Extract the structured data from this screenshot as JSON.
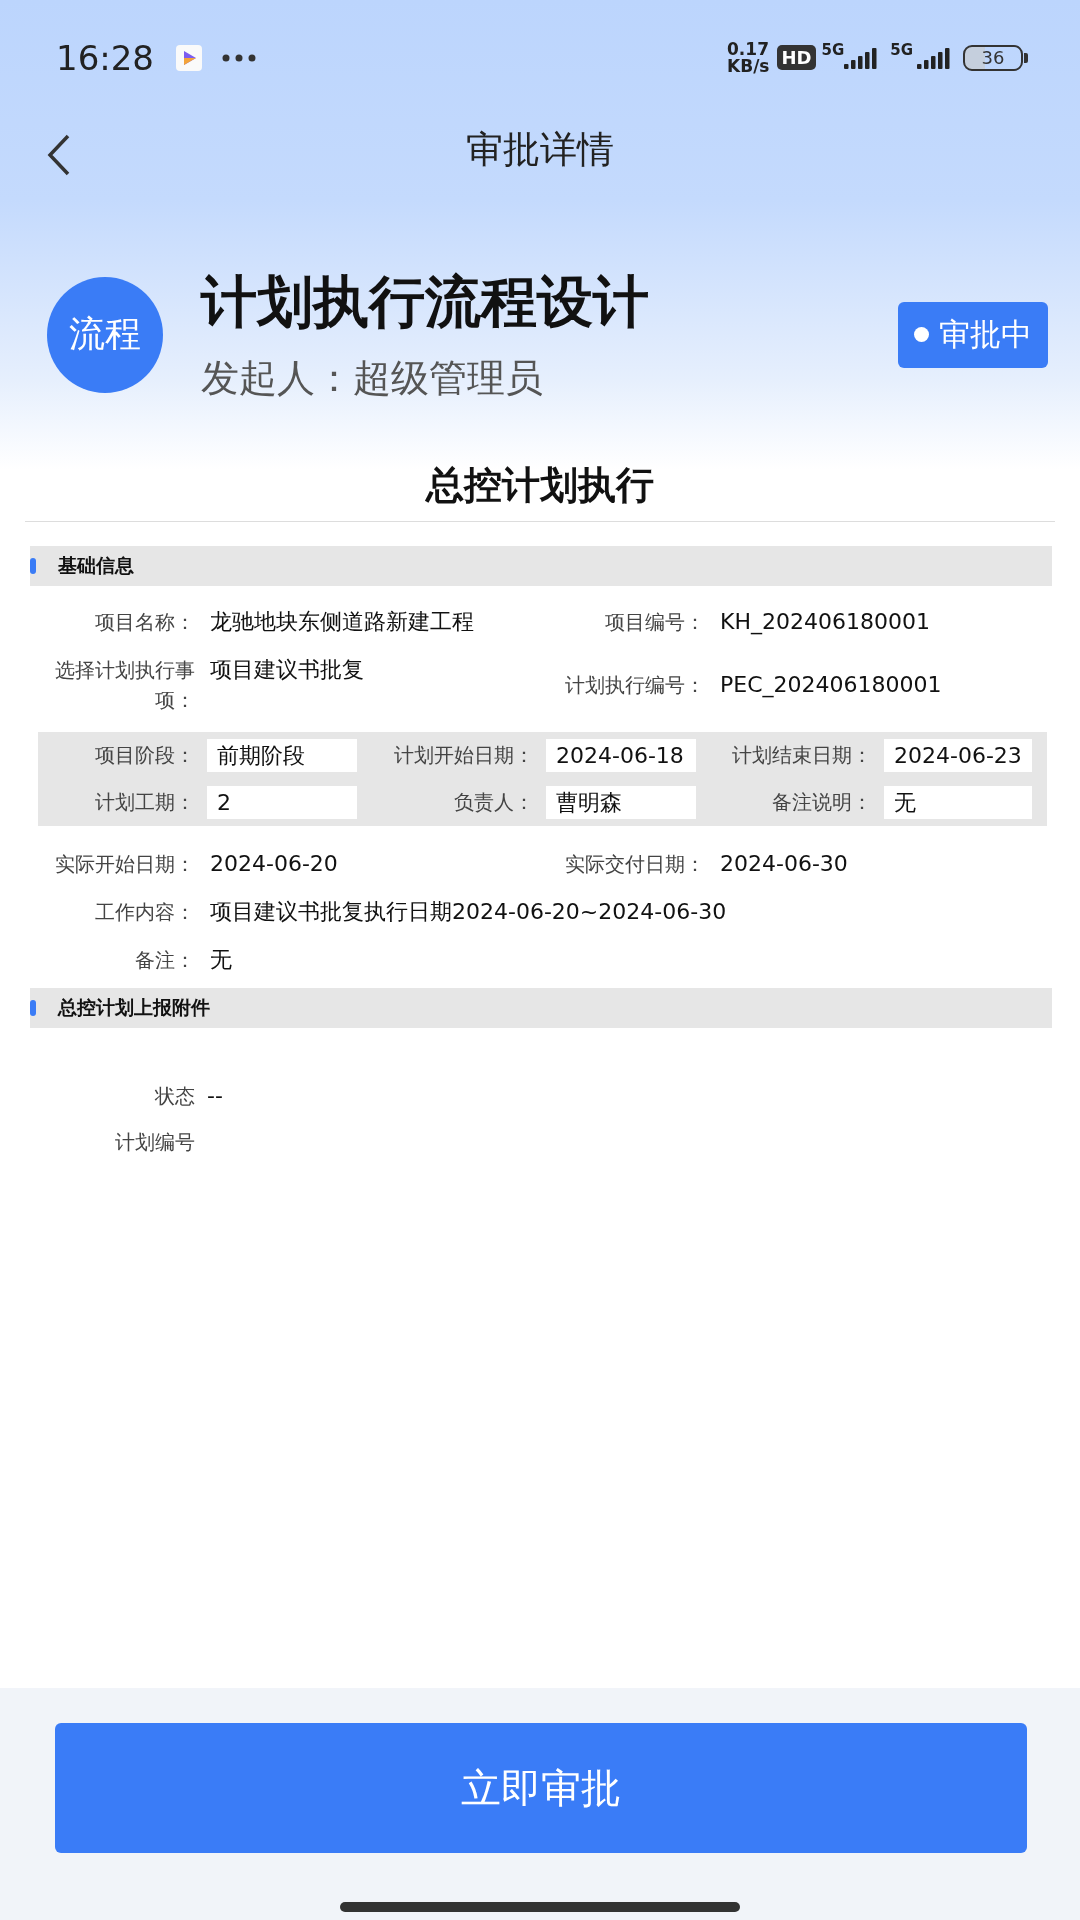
{
  "status_bar": {
    "time": "16:28",
    "speed_value": "0.17",
    "speed_unit": "KB/s",
    "hd_badge": "HD",
    "sim_labels": [
      "5G",
      "5G"
    ],
    "battery": "36"
  },
  "nav": {
    "title": "审批详情"
  },
  "header": {
    "avatar_text": "流程",
    "title": "计划执行流程设计",
    "initiator": "发起人：超级管理员",
    "status": "审批中"
  },
  "form_title": "总控计划执行",
  "basic_section": {
    "title": "基础信息",
    "top_fields": [
      {
        "label": "项目名称：",
        "value": "龙驰地块东侧道路新建工程"
      },
      {
        "label": "项目编号：",
        "value": "KH_202406180001"
      },
      {
        "label": "选择计划执行事项：",
        "value": "项目建议书批复"
      },
      {
        "label": "计划执行编号：",
        "value": "PEC_202406180001"
      }
    ],
    "plan_grid": [
      {
        "label": "项目阶段：",
        "value": "前期阶段"
      },
      {
        "label": "计划开始日期：",
        "value": "2024-06-18"
      },
      {
        "label": "计划结束日期：",
        "value": "2024-06-23"
      },
      {
        "label": "计划工期：",
        "value": "2"
      },
      {
        "label": "负责人：",
        "value": "曹明森"
      },
      {
        "label": "备注说明：",
        "value": "无"
      }
    ],
    "bottom_fields": [
      {
        "label": "实际开始日期：",
        "value": "2024-06-20",
        "kind": "half"
      },
      {
        "label": "实际交付日期：",
        "value": "2024-06-30",
        "kind": "half"
      },
      {
        "label": "工作内容：",
        "value": "项目建议书批复执行日期2024-06-20~2024-06-30",
        "kind": "full"
      },
      {
        "label": "备注：",
        "value": "无",
        "kind": "full"
      }
    ]
  },
  "attachment_section": {
    "title": "总控计划上报附件",
    "status_field": {
      "label": "状态",
      "value": "--"
    },
    "plan_number_label": "计划编号"
  },
  "approve_button": "立即审批"
}
